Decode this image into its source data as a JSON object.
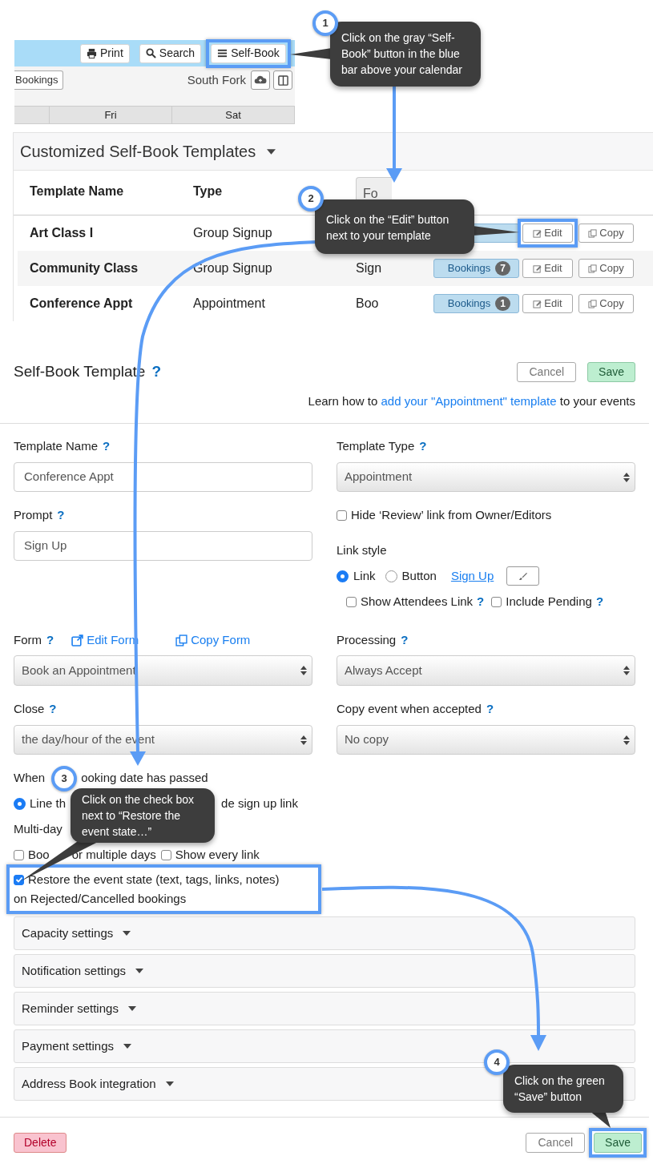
{
  "calendar": {
    "toolbar_buttons": [
      {
        "label": "Print"
      },
      {
        "label": "Search"
      },
      {
        "label": "Self-Book",
        "highlighted": true
      }
    ],
    "bookings_button": "Bookings",
    "calendar_name": "South Fork",
    "day_headers": [
      "Fri",
      "Sat"
    ]
  },
  "templates": {
    "title": "Customized Self-Book Templates",
    "columns": [
      "Template Name",
      "Type",
      "Fo"
    ],
    "rows": [
      {
        "name": "Art Class I",
        "type": "Group Signup",
        "edit": "Edit",
        "copy": "Copy",
        "edit_highlighted": true
      },
      {
        "name": "Community Class",
        "type": "Group Signup",
        "column_3": "Sign",
        "bookings_label": "Bookings",
        "bookings_count": "7",
        "edit": "Edit",
        "copy": "Copy"
      },
      {
        "name": "Conference Appt",
        "type": "Appointment",
        "column_3": "Boo",
        "bookings_label": "Bookings",
        "bookings_count": "1",
        "edit": "Edit",
        "copy": "Copy"
      }
    ]
  },
  "editor": {
    "title": "Self-Book Template",
    "help": "?",
    "cancel": "Cancel",
    "save": "Save",
    "learn_prefix": "Learn how to",
    "learn_link": "add your \"Appointment\" template",
    "learn_suffix": "to your events",
    "template_name": {
      "label": "Template Name",
      "help": "?",
      "value": "Conference Appt"
    },
    "prompt": {
      "label": "Prompt",
      "help": "?",
      "value": "Sign Up"
    },
    "template_type": {
      "label": "Template Type",
      "help": "?",
      "value": "Appointment"
    },
    "hide_review": {
      "label": "Hide ‘Review’ link from Owner/Editors",
      "checked": false
    },
    "link_style": {
      "label": "Link style",
      "options": [
        {
          "label": "Link",
          "selected": true
        },
        {
          "label": "Button",
          "selected": false
        }
      ],
      "preview_link": "Sign Up"
    },
    "link_options": [
      {
        "label": "Show Attendees Link",
        "help": "?",
        "checked": false
      },
      {
        "label": "Include Pending",
        "help": "?",
        "checked": false
      }
    ],
    "form": {
      "label": "Form",
      "help": "?",
      "edit_link": "Edit Form",
      "copy_link": "Copy Form",
      "value": "Book an Appointment"
    },
    "processing": {
      "label": "Processing",
      "help": "?",
      "value": "Always Accept"
    },
    "close": {
      "label": "Close",
      "help": "?",
      "value": "the day/hour of the event"
    },
    "copy_event": {
      "label": "Copy event when accepted",
      "help": "?",
      "value": "No copy"
    },
    "when_passed": {
      "label_start": "When",
      "label_end": "ooking date has passed",
      "option_start": "Line th",
      "option_end": "de sign up link",
      "selected": true
    },
    "multi_day": {
      "label": "Multi-day",
      "options": [
        {
          "label_start": "Boo",
          "label_end": "or multiple days",
          "checked": false
        },
        {
          "label": "Show every link",
          "checked": false
        }
      ]
    },
    "restore": {
      "label_lines": [
        "Restore the event state (text, tags, links, notes)",
        "on Rejected/Cancelled bookings"
      ],
      "checked": true,
      "highlighted": true
    },
    "sections": [
      "Capacity settings",
      "Notification settings",
      "Reminder settings",
      "Payment settings",
      "Address Book integration"
    ],
    "delete": "Delete",
    "footer_cancel": "Cancel",
    "footer_save": "Save",
    "footer_save_highlighted": true
  },
  "callouts": [
    {
      "number": "1",
      "text": "Click on the gray “Self-Book” button in the blue bar above your calendar"
    },
    {
      "number": "2",
      "text": "Click on the “Edit” button next to your template"
    },
    {
      "number": "3",
      "text": "Click on the check box next to “Restore the event state…”"
    },
    {
      "number": "4",
      "text": "Click on the green “Save” button"
    }
  ]
}
